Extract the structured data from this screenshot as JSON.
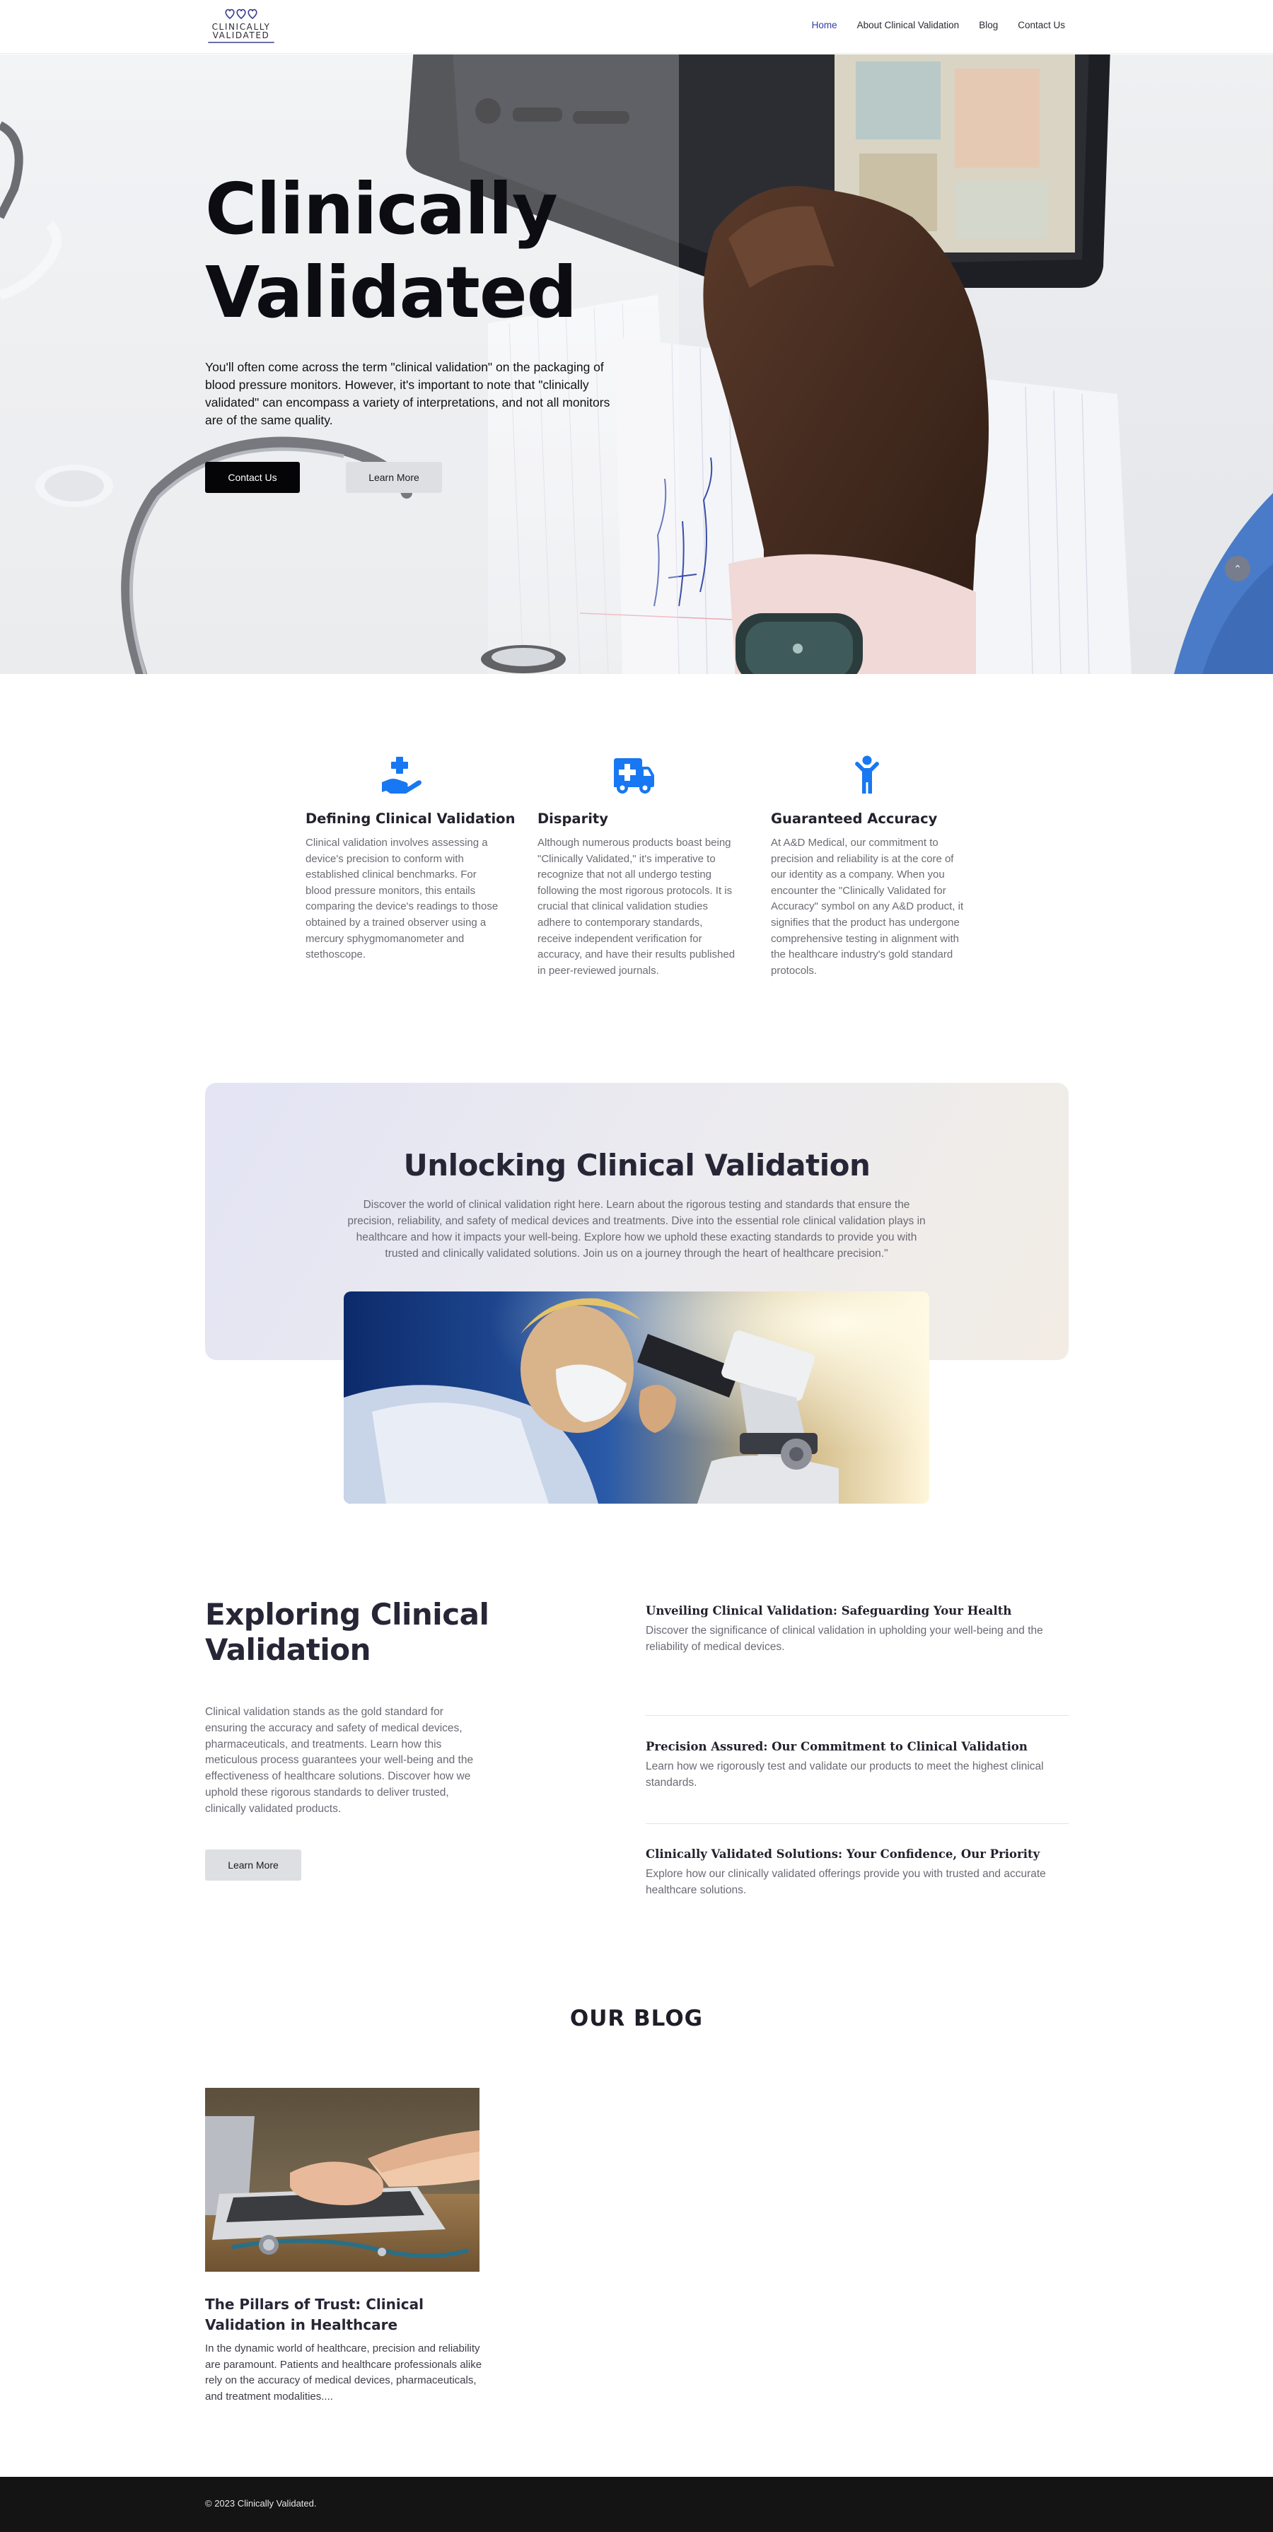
{
  "brand": {
    "logo_line1": "CLINICALLY",
    "logo_line2": "VALIDATED"
  },
  "nav": {
    "items": [
      {
        "label": "Home",
        "active": true
      },
      {
        "label": "About Clinical Validation",
        "active": false
      },
      {
        "label": "Blog",
        "active": false
      },
      {
        "label": "Contact Us",
        "active": false
      }
    ]
  },
  "hero": {
    "title": "Clinically Validated",
    "text": "You'll often come across the term \"clinical validation\" on the packaging of blood pressure monitors. However, it's important to note that \"clinically validated\" can encompass a variety of interpretations, and not all monitors are of the same quality.",
    "primary_button": "Contact Us",
    "secondary_button": "Learn More",
    "scroll_top_icon": "chevron-up-icon"
  },
  "features": [
    {
      "icon": "hand-medical-icon",
      "title": "Defining Clinical Validation",
      "text": "Clinical validation involves assessing a device's precision to conform with established clinical benchmarks. For blood pressure monitors, this entails comparing the device's readings to those obtained by a trained observer using a mercury sphygmomanometer and stethoscope."
    },
    {
      "icon": "ambulance-icon",
      "title": "Disparity",
      "text": "Although numerous products boast being \"Clinically Validated,\" it's imperative to recognize that not all undergo testing following the most rigorous protocols. It is crucial that clinical validation studies adhere to contemporary standards, receive independent verification for accuracy, and have their results published in peer-reviewed journals."
    },
    {
      "icon": "person-icon",
      "title": "Guaranteed Accuracy",
      "text": "At A&D Medical, our commitment to precision and reliability is at the core of our identity as a company. When you encounter the \"Clinically Validated for Accuracy\" symbol on any A&D product, it signifies that the product has undergone comprehensive testing in alignment with the healthcare industry's gold standard protocols."
    }
  ],
  "unlocking": {
    "title": "Unlocking Clinical Validation",
    "text": "Discover the world of clinical validation right here. Learn about the rigorous testing and standards that ensure the precision, reliability, and safety of medical devices and treatments. Dive into the essential role clinical validation plays in healthcare and how it impacts your well-being. Explore how we uphold these exacting standards to provide you with trusted and clinically validated solutions. Join us on a journey through the heart of healthcare precision.\""
  },
  "exploring": {
    "title": "Exploring Clinical Validation",
    "text": "Clinical validation stands as the gold standard for ensuring the accuracy and safety of medical devices, pharmaceuticals, and treatments. Learn how this meticulous process guarantees your well-being and the effectiveness of healthcare solutions. Discover how we uphold these rigorous standards to deliver trusted, clinically validated products.",
    "button": "Learn More",
    "items": [
      {
        "title": "Unveiling Clinical Validation: Safeguarding Your Health",
        "text": "Discover the significance of clinical validation in upholding your well-being and the reliability of medical devices."
      },
      {
        "title": "Precision Assured: Our Commitment to Clinical Validation",
        "text": "Learn how we rigorously test and validate our products to meet the highest clinical standards."
      },
      {
        "title": "Clinically Validated Solutions: Your Confidence, Our Priority",
        "text": "Explore how our clinically validated offerings provide you with trusted and accurate healthcare solutions."
      }
    ]
  },
  "blog": {
    "title": "OUR BLOG",
    "posts": [
      {
        "title": "The Pillars of Trust: Clinical Validation in Healthcare",
        "excerpt": "In the dynamic world of healthcare, precision and reliability are paramount. Patients and healthcare professionals alike rely on the accuracy of medical devices, pharmaceuticals, and treatment modalities...."
      }
    ]
  },
  "footer": {
    "copyright": "© 2023 Clinically Validated."
  },
  "colors": {
    "accent_blue": "#1877f2",
    "nav_active": "#2f3ea8",
    "footer_bg": "#141414"
  }
}
